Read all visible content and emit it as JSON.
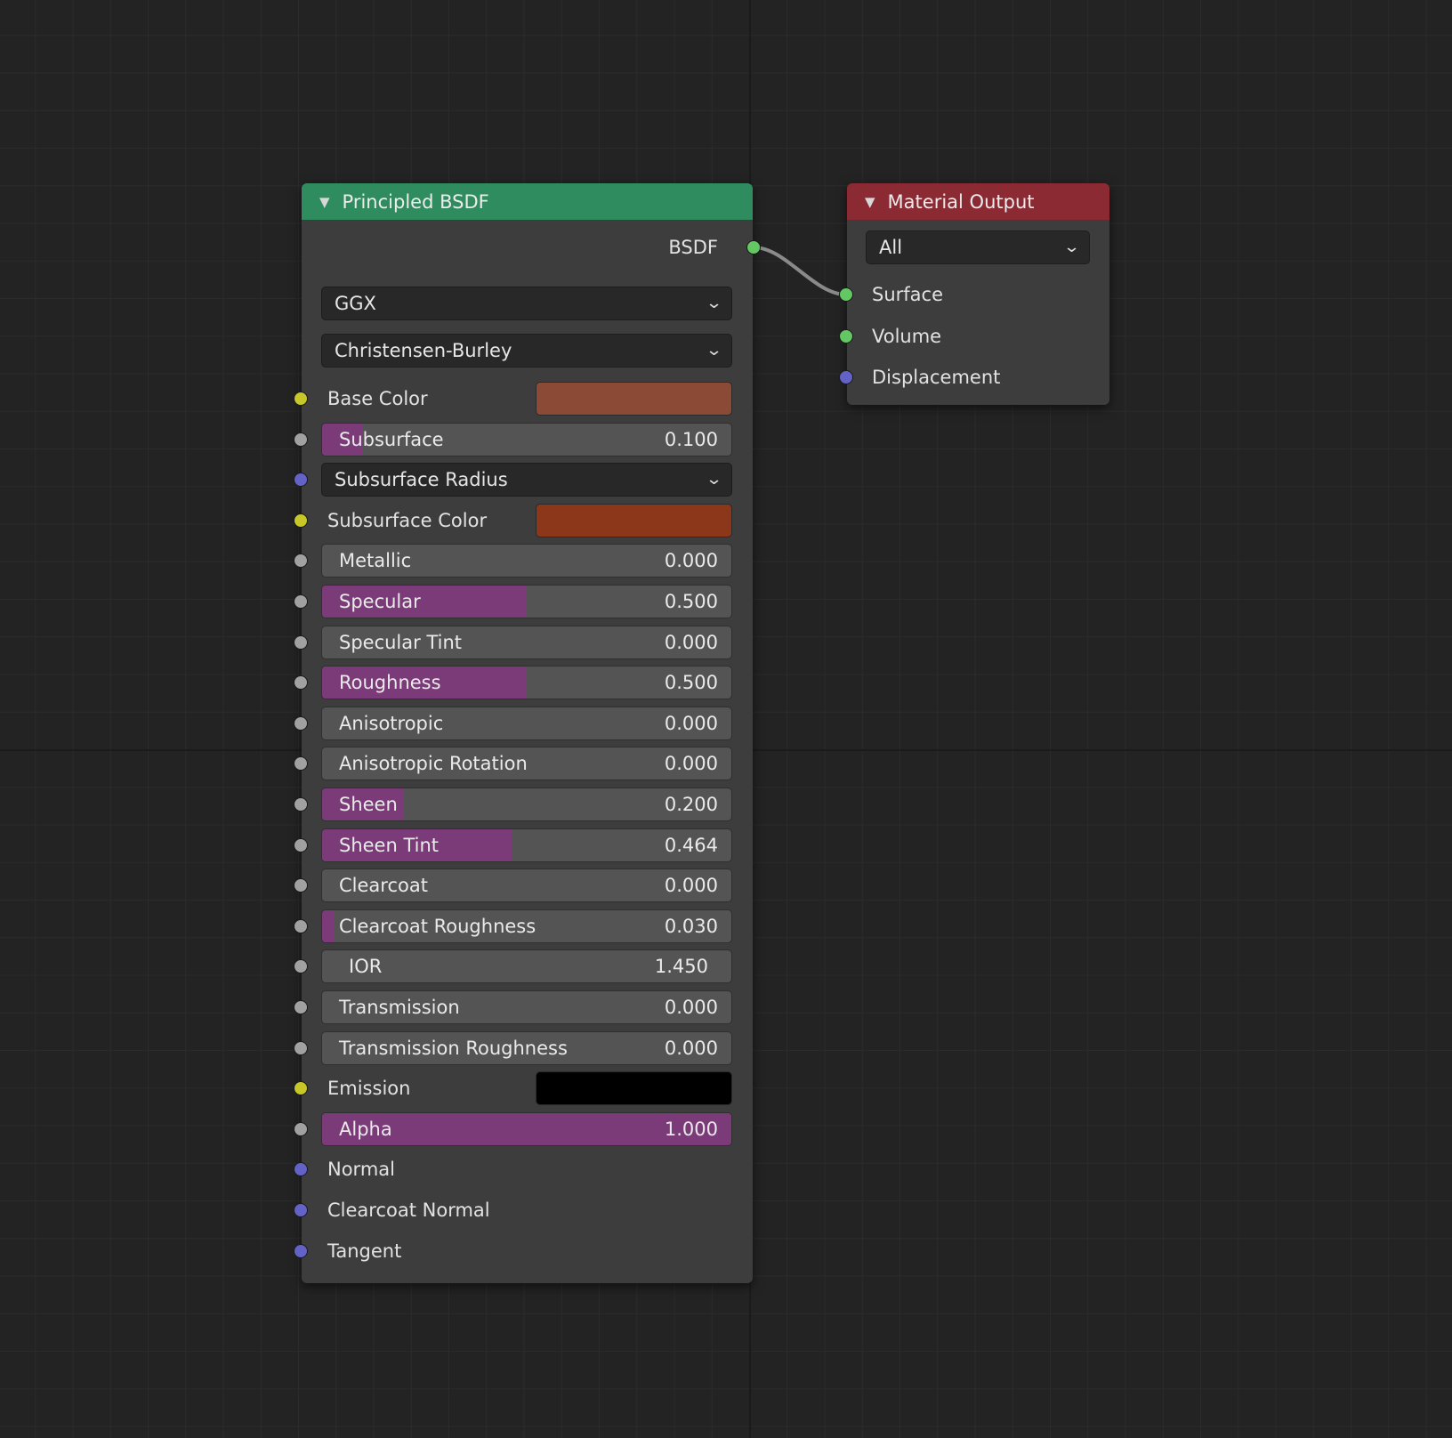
{
  "principled": {
    "title": "Principled BSDF",
    "header_color": "#2f8c5f",
    "output_label": "BSDF",
    "distribution": "GGX",
    "subsurface_method": "Christensen-Burley",
    "inputs": [
      {
        "kind": "color",
        "label": "Base Color",
        "color": "#8a4a35",
        "socket": "yellow"
      },
      {
        "kind": "slider",
        "label": "Subsurface",
        "value": "0.100",
        "fraction": 0.1,
        "socket": "grey"
      },
      {
        "kind": "dropdown",
        "label": "Subsurface Radius",
        "socket": "blue"
      },
      {
        "kind": "color",
        "label": "Subsurface Color",
        "color": "#8c361a",
        "socket": "yellow"
      },
      {
        "kind": "slider",
        "label": "Metallic",
        "value": "0.000",
        "fraction": 0.0,
        "socket": "grey"
      },
      {
        "kind": "slider",
        "label": "Specular",
        "value": "0.500",
        "fraction": 0.5,
        "socket": "grey"
      },
      {
        "kind": "slider",
        "label": "Specular Tint",
        "value": "0.000",
        "fraction": 0.0,
        "socket": "grey"
      },
      {
        "kind": "slider",
        "label": "Roughness",
        "value": "0.500",
        "fraction": 0.5,
        "socket": "grey"
      },
      {
        "kind": "slider",
        "label": "Anisotropic",
        "value": "0.000",
        "fraction": 0.0,
        "socket": "grey"
      },
      {
        "kind": "slider",
        "label": "Anisotropic Rotation",
        "value": "0.000",
        "fraction": 0.0,
        "socket": "grey"
      },
      {
        "kind": "slider",
        "label": "Sheen",
        "value": "0.200",
        "fraction": 0.2,
        "socket": "grey"
      },
      {
        "kind": "slider",
        "label": "Sheen Tint",
        "value": "0.464",
        "fraction": 0.464,
        "socket": "grey"
      },
      {
        "kind": "slider",
        "label": "Clearcoat",
        "value": "0.000",
        "fraction": 0.0,
        "socket": "grey"
      },
      {
        "kind": "slider",
        "label": "Clearcoat Roughness",
        "value": "0.030",
        "fraction": 0.03,
        "socket": "grey"
      },
      {
        "kind": "number",
        "label": "IOR",
        "value": "1.450",
        "socket": "grey"
      },
      {
        "kind": "slider",
        "label": "Transmission",
        "value": "0.000",
        "fraction": 0.0,
        "socket": "grey"
      },
      {
        "kind": "slider",
        "label": "Transmission Roughness",
        "value": "0.000",
        "fraction": 0.0,
        "socket": "grey"
      },
      {
        "kind": "color",
        "label": "Emission",
        "color": "#000000",
        "socket": "yellow"
      },
      {
        "kind": "slider",
        "label": "Alpha",
        "value": "1.000",
        "fraction": 1.0,
        "socket": "grey"
      },
      {
        "kind": "socket",
        "label": "Normal",
        "socket": "blue"
      },
      {
        "kind": "socket",
        "label": "Clearcoat Normal",
        "socket": "blue"
      },
      {
        "kind": "socket",
        "label": "Tangent",
        "socket": "blue"
      }
    ]
  },
  "material_output": {
    "title": "Material Output",
    "header_color": "#8c2a34",
    "target": "All",
    "inputs": [
      {
        "label": "Surface",
        "socket": "green"
      },
      {
        "label": "Volume",
        "socket": "green"
      },
      {
        "label": "Displacement",
        "socket": "blue"
      }
    ]
  },
  "colors": {
    "slider_fill": "#7a3b78",
    "link": "#8a8a8a"
  }
}
